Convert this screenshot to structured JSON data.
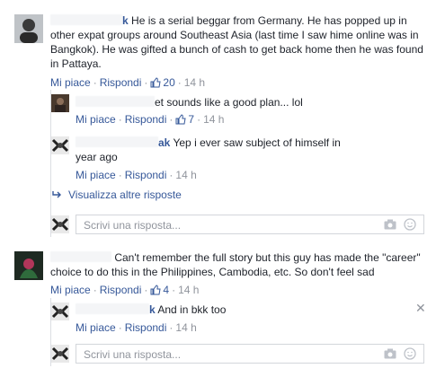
{
  "comments": [
    {
      "text": "He is a serial beggar from Germany. He has popped up in other expat groups around Southeast Asia (last time I saw hime online was in Bangkok). He was gifted a bunch of cash to get back home then he was found in Pattaya.",
      "name_tail": "k",
      "like_label": "Mi piace",
      "reply_label": "Rispondi",
      "like_count": "20",
      "time": "14 h",
      "replies": [
        {
          "name_tail": "",
          "text": "et sounds like a good plan... lol",
          "like_label": "Mi piace",
          "reply_label": "Rispondi",
          "like_count": "7",
          "time": "14 h"
        },
        {
          "name_tail": "ak",
          "text": "Yep i ever saw subject of himself in year ago",
          "like_label": "Mi piace",
          "reply_label": "Rispondi",
          "time": "14 h"
        }
      ],
      "more_replies": "Visualizza altre risposte",
      "input_placeholder": "Scrivi una risposta..."
    },
    {
      "text": "Can't remember the full story but this guy has made the \"career\" choice to do this in the Philippines, Cambodia, etc. So don't feel sad",
      "like_label": "Mi piace",
      "reply_label": "Rispondi",
      "like_count": "4",
      "time": "14 h",
      "replies": [
        {
          "name_tail": "k",
          "text": "And in bkk too",
          "like_label": "Mi piace",
          "reply_label": "Rispondi",
          "time": "14 h"
        }
      ],
      "input_placeholder": "Scrivi una risposta..."
    }
  ],
  "colors": {
    "link": "#365899",
    "meta": "#90949c",
    "text": "#1d2129"
  },
  "icons": [
    "like-icon",
    "reply-arrow-icon",
    "camera-icon",
    "smiley-icon",
    "close-icon"
  ]
}
